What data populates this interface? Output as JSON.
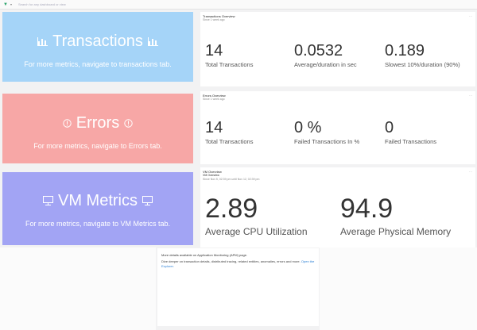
{
  "topbar": {
    "search_placeholder": "Search for any dashboard or view"
  },
  "tiles": {
    "transactions": {
      "title": "Transactions",
      "subtitle": "For more metrics, navigate to transactions tab.",
      "icon": "bar-chart-icon",
      "color": "#a5d4f8"
    },
    "errors": {
      "title": "Errors",
      "subtitle": "For more metrics, navigate to Errors tab.",
      "icon": "alert-circle-icon",
      "color": "#f7a7a6"
    },
    "vm": {
      "title": "VM Metrics",
      "subtitle": "For more metrics, navigate to VM Metrics tab.",
      "icon": "monitor-icon",
      "color": "#a2a4f4"
    }
  },
  "panels": {
    "transactions": {
      "title": "Transactions Overview",
      "since": "Since 1 week ago",
      "metrics": [
        {
          "value": "14",
          "label": "Total Transactions"
        },
        {
          "value": "0.0532",
          "label": "Average/duration in sec"
        },
        {
          "value": "0.189",
          "label": "Slowest 10%/duration (90%)"
        }
      ]
    },
    "errors": {
      "title": "Errors Overview",
      "since": "Since 1 week ago",
      "metrics": [
        {
          "value": "14",
          "label": "Total Transactions"
        },
        {
          "value": "0 %",
          "label": "Failed Transactions In %"
        },
        {
          "value": "0",
          "label": "Failed Transactions"
        }
      ]
    },
    "vm": {
      "title": "VM Overview",
      "subtitle": "VM Overview",
      "since": "Since Nov 5, 02:39 pm until Nov 12, 02:39 pm",
      "metrics": [
        {
          "value": "2.89",
          "label": "Average CPU Utilization"
        },
        {
          "value": "94.9",
          "label": "Average Physical Memory"
        }
      ]
    }
  },
  "info": {
    "title": "More details available on Application Monitoring (APM) page.",
    "body": "Dive deeper on transaction details, distributed tracing, related entities, anomalies, errors and more.",
    "link": "Open the Explorer."
  }
}
